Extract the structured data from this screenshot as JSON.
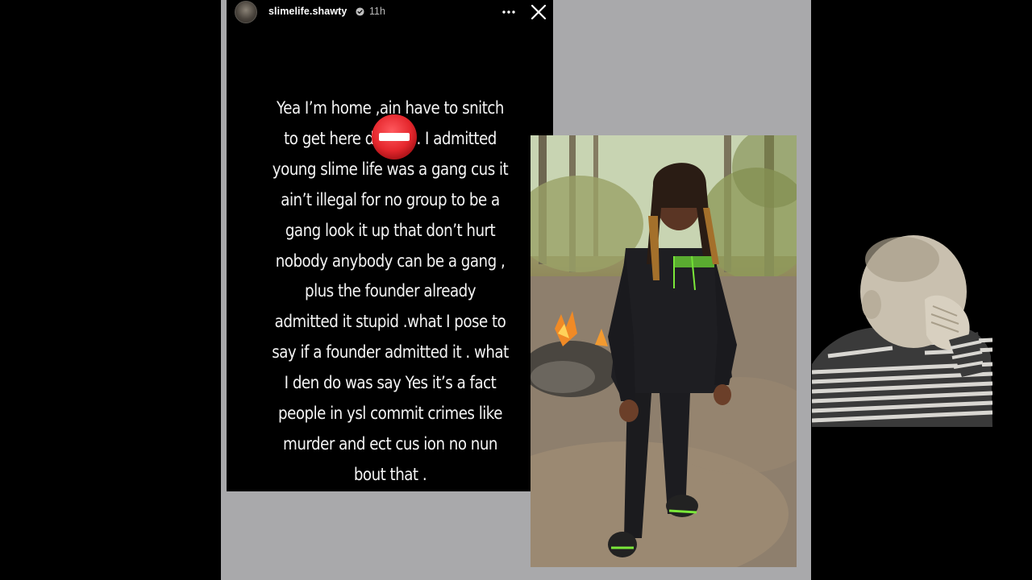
{
  "story": {
    "username": "slimelife.shawty",
    "timestamp": "11h",
    "icons": {
      "verified": "verified-badge-icon",
      "more": "more-options-icon",
      "close": "close-icon",
      "overlay": "no-entry-icon"
    },
    "text_lines": [
      "Yea I’m home ,ain have to snitch",
      "to get here di      d . I admitted",
      "young slime life was a gang cus it",
      "ain’t illegal for no group to be a",
      "gang look it up that don’t hurt",
      "nobody anybody can be a gang ,",
      "plus the founder already",
      "admitted it stupid .what I pose to",
      "say if a founder admitted it . what",
      "I den do was say Yes it’s a fact",
      "people in ysl commit crimes like",
      "murder and ect cus ion no nun",
      "bout that ."
    ]
  },
  "colors": {
    "background": "#000000",
    "panel": "#a9a9ab",
    "story_bg": "#000000",
    "text": "#f4f4f4",
    "no_entry_red": "#e5272d",
    "hoodie_accent": "#7be83a"
  }
}
